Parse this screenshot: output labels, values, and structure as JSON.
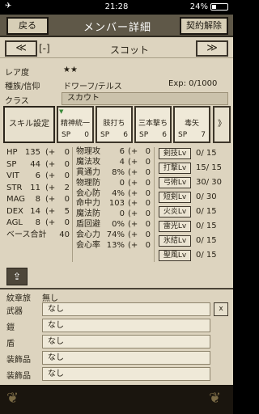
{
  "status": {
    "time": "21:28",
    "battery": "24%"
  },
  "header": {
    "back": "戻る",
    "title": "メンバー詳細",
    "release": "契約解除"
  },
  "nav": {
    "prev": "≪",
    "bracket": "[-]",
    "name": "スコット",
    "next": "≫"
  },
  "info": {
    "rarity_label": "レア度",
    "rarity": "★★",
    "race_label": "種族/信仰",
    "race": "ドワーフ/テルス",
    "exp_label": "Exp",
    "exp": "0/1000",
    "class_label": "クラス",
    "class": "スカウト"
  },
  "skills": {
    "setting": "スキル設定",
    "items": [
      {
        "name": "精神統一",
        "sp": "SP",
        "val": "0",
        "corner": "▼"
      },
      {
        "name": "肢打ち",
        "sp": "SP",
        "val": "6",
        "corner": ""
      },
      {
        "name": "三本撃ち",
        "sp": "SP",
        "val": "6",
        "corner": ""
      },
      {
        "name": "毒矢",
        "sp": "SP",
        "val": "7",
        "corner": ""
      }
    ],
    "more": "》"
  },
  "base_stats": [
    {
      "name": "HP",
      "val": "135",
      "plus": "(+",
      "bonus": "0"
    },
    {
      "name": "SP",
      "val": "44",
      "plus": "(+",
      "bonus": "0"
    },
    {
      "name": "VIT",
      "val": "6",
      "plus": "(+",
      "bonus": "0"
    },
    {
      "name": "STR",
      "val": "11",
      "plus": "(+",
      "bonus": "2"
    },
    {
      "name": "MAG",
      "val": "8",
      "plus": "(+",
      "bonus": "0"
    },
    {
      "name": "DEX",
      "val": "14",
      "plus": "(+",
      "bonus": "5"
    },
    {
      "name": "AGL",
      "val": "8",
      "plus": "(+",
      "bonus": "0"
    },
    {
      "name": "ベース合計",
      "val": "40",
      "plus": "",
      "bonus": ""
    }
  ],
  "combat_stats": [
    {
      "name": "物理攻",
      "val": "6",
      "plus": "(+",
      "bonus": "0"
    },
    {
      "name": "魔法攻",
      "val": "4",
      "plus": "(+",
      "bonus": "0"
    },
    {
      "name": "貫通力",
      "val": "8%",
      "plus": "(+",
      "bonus": "0"
    },
    {
      "name": "物理防",
      "val": "0",
      "plus": "(+",
      "bonus": "0"
    },
    {
      "name": "会心防",
      "val": "4%",
      "plus": "(+",
      "bonus": "0"
    },
    {
      "name": "命中力",
      "val": "103",
      "plus": "(+",
      "bonus": "0"
    },
    {
      "name": "魔法防",
      "val": "0",
      "plus": "(+",
      "bonus": "0"
    },
    {
      "name": "盾回避",
      "val": "0%",
      "plus": "(+",
      "bonus": "0"
    },
    {
      "name": "会心力",
      "val": "74%",
      "plus": "(+",
      "bonus": "0"
    },
    {
      "name": "会心率",
      "val": "13%",
      "plus": "(+",
      "bonus": "0"
    }
  ],
  "skill_levels": [
    {
      "name": "剣技Lv",
      "val": "0/ 15"
    },
    {
      "name": "打撃Lv",
      "val": "15/ 15"
    },
    {
      "name": "弓術Lv",
      "val": "30/ 30"
    },
    {
      "name": "短剣Lv",
      "val": "0/ 30"
    },
    {
      "name": "火炎Lv",
      "val": "0/ 15"
    },
    {
      "name": "雷光Lv",
      "val": "0/ 15"
    },
    {
      "name": "氷結Lv",
      "val": "0/ 15"
    },
    {
      "name": "聖風Lv",
      "val": "0/ 15"
    }
  ],
  "share_icon": "share-icon",
  "equipment": {
    "crest_label": "紋章旅",
    "crest": "無し",
    "items": [
      {
        "label": "武器",
        "value": "なし",
        "x": "x"
      },
      {
        "label": "鎧",
        "value": "なし"
      },
      {
        "label": "盾",
        "value": "なし"
      },
      {
        "label": "装飾品",
        "value": "なし"
      },
      {
        "label": "装飾品",
        "value": "なし"
      }
    ]
  }
}
